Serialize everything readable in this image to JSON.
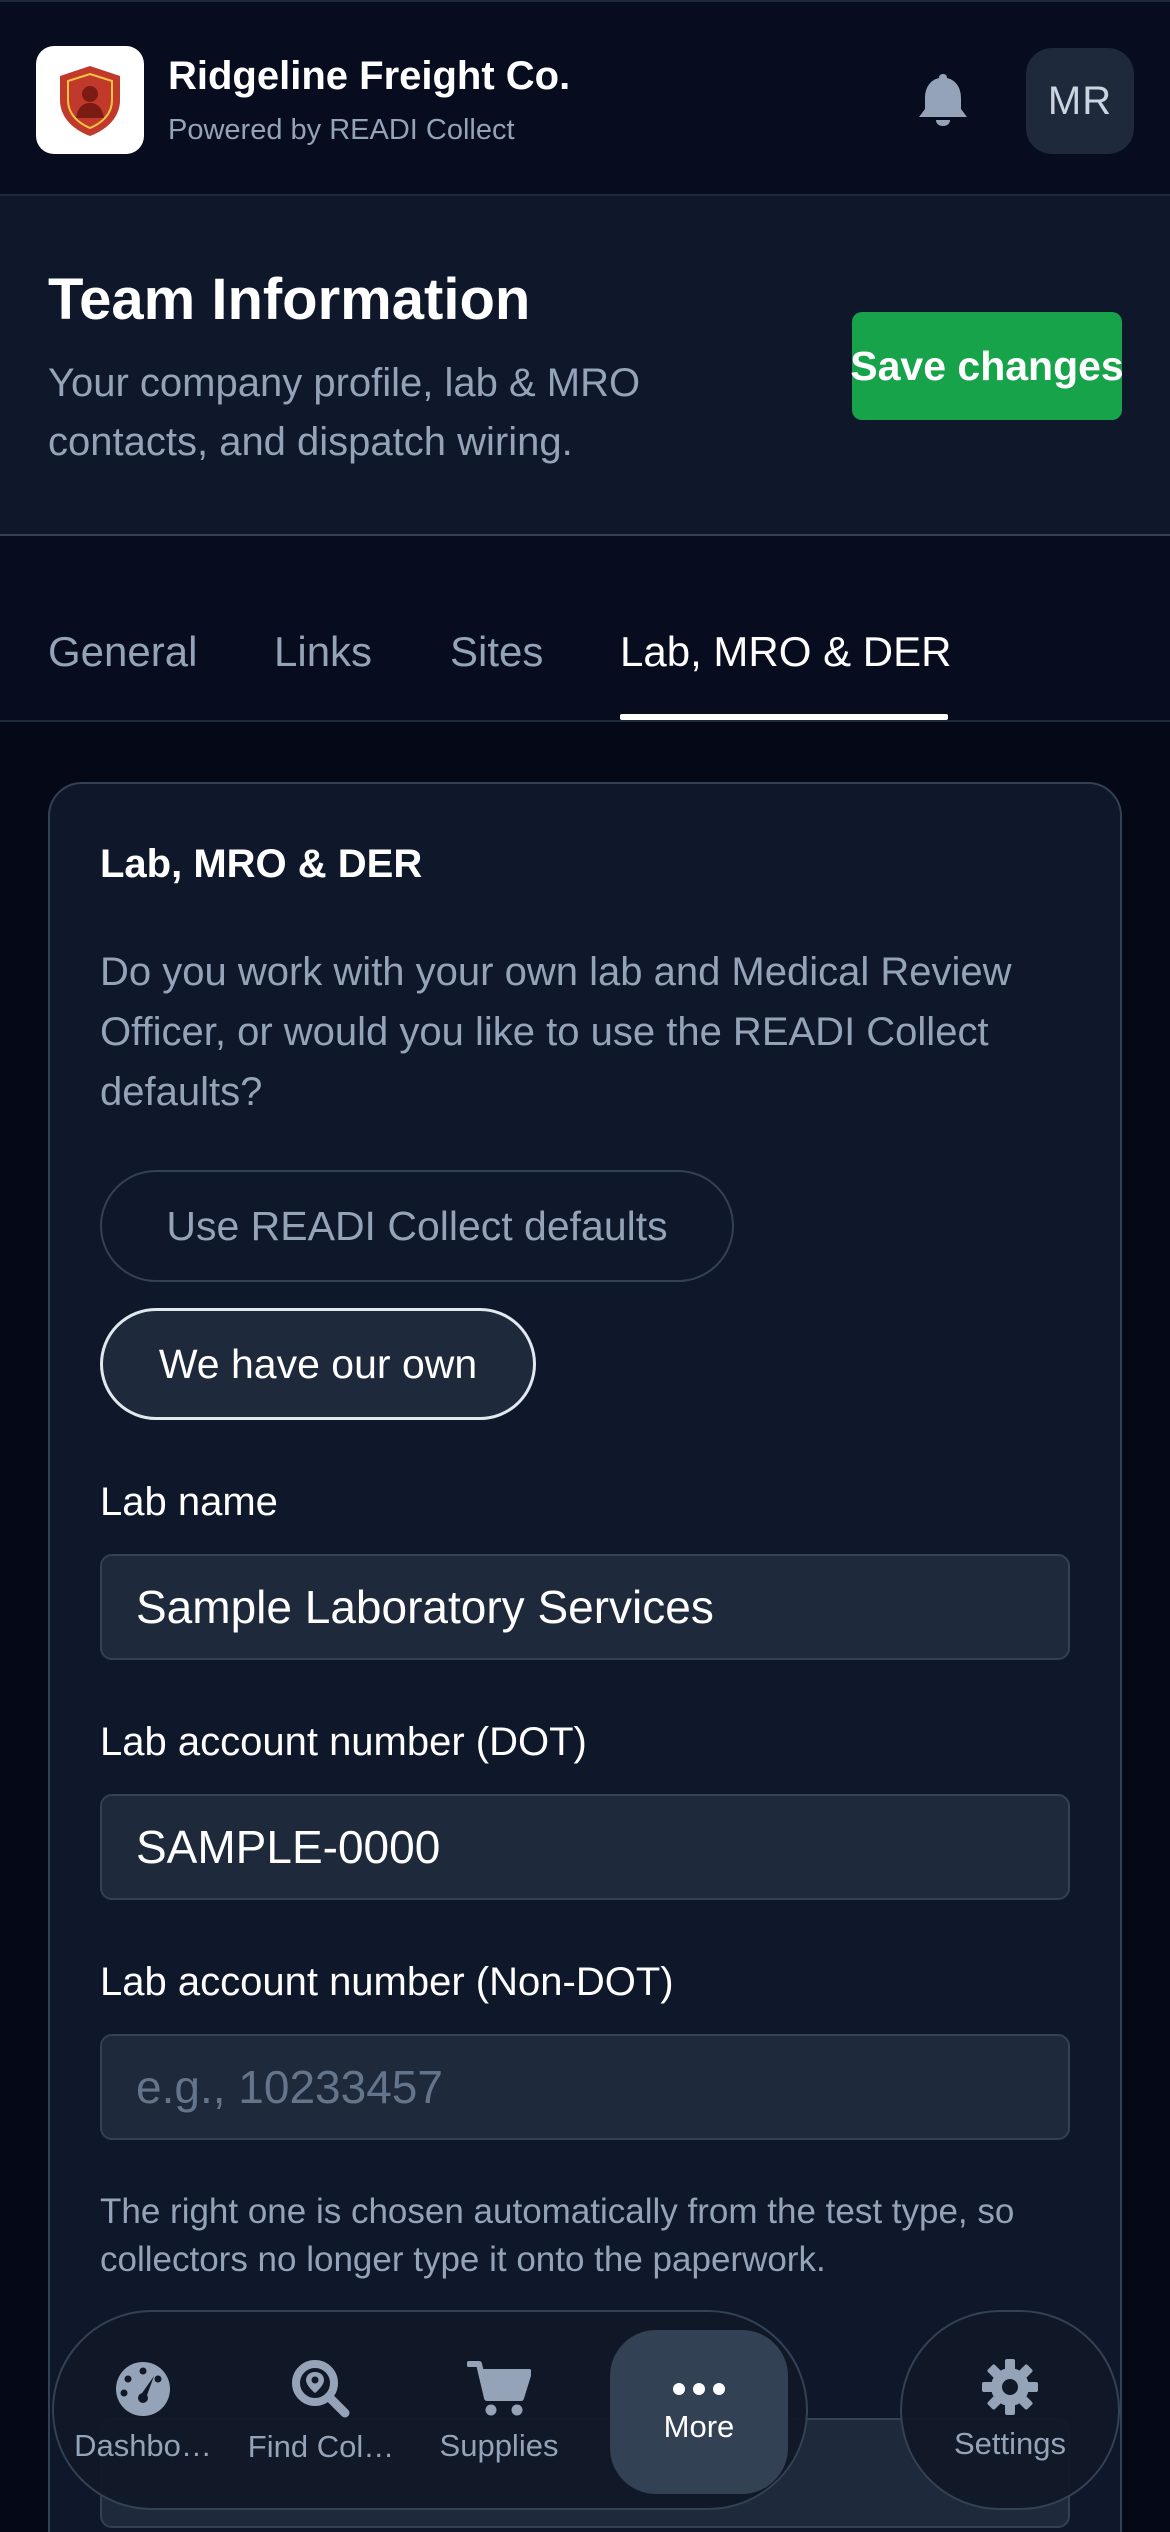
{
  "app": {
    "name": "Ridgeline Freight Co.",
    "subtitle": "Powered by READI Collect",
    "avatar_initials": "MR"
  },
  "header": {
    "title": "Team Information",
    "description": "Your company profile, lab & MRO contacts, and dispatch wiring.",
    "save_label": "Save changes"
  },
  "tabs": [
    {
      "label": "General",
      "active": false
    },
    {
      "label": "Links",
      "active": false
    },
    {
      "label": "Sites",
      "active": false
    },
    {
      "label": "Lab, MRO & DER",
      "active": true
    }
  ],
  "card": {
    "title": "Lab, MRO & DER",
    "question": "Do you work with your own lab and Medical Review Officer, or would you like to use the READI Collect defaults?",
    "options": {
      "defaults_label": "Use READI Collect defaults",
      "own_label": "We have our own",
      "selected": "own"
    },
    "lab_name": {
      "label": "Lab name",
      "value": "Sample Laboratory Services"
    },
    "lab_account_dot": {
      "label": "Lab account number (DOT)",
      "value": "SAMPLE-0000"
    },
    "lab_account_non_dot": {
      "label": "Lab account number (Non-DOT)",
      "value": "",
      "placeholder": "e.g., 10233457"
    },
    "help_text": "The right one is chosen automatically from the test type, so collectors no longer type it onto the paperwork."
  },
  "bottom_nav": {
    "items": [
      {
        "label": "Dashbo…",
        "icon": "dashboard-gauge-icon",
        "active": false
      },
      {
        "label": "Find Col…",
        "icon": "search-location-icon",
        "active": false
      },
      {
        "label": "Supplies",
        "icon": "cart-icon",
        "active": false
      },
      {
        "label": "More",
        "icon": "more-dots-icon",
        "active": true
      }
    ],
    "settings_label": "Settings"
  },
  "colors": {
    "background": "#050816",
    "surface": "#0f172a",
    "accent_green": "#16a34a",
    "logo_red": "#c0392b"
  }
}
